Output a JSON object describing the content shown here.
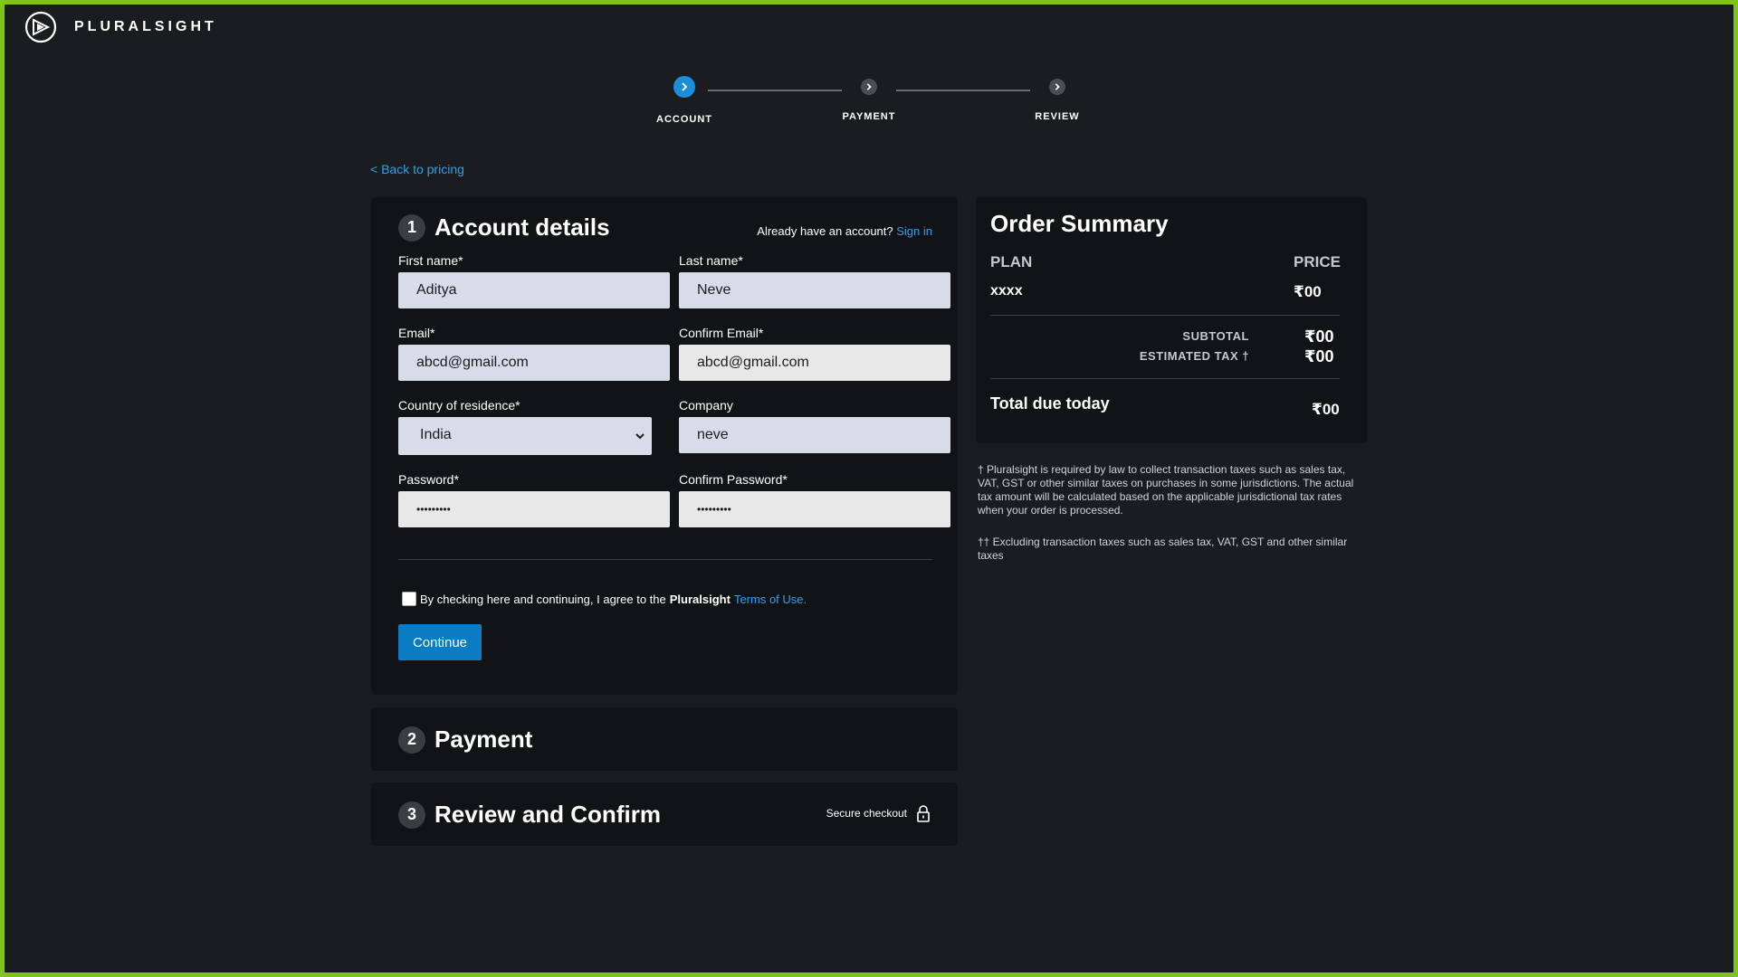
{
  "brand": {
    "name": "PLURALSIGHT"
  },
  "stepper": {
    "steps": [
      {
        "label": "ACCOUNT",
        "state": "active"
      },
      {
        "label": "PAYMENT",
        "state": "inactive"
      },
      {
        "label": "REVIEW",
        "state": "inactive"
      }
    ]
  },
  "back_link": "< Back to pricing",
  "account": {
    "number": "1",
    "title": "Account details",
    "signin_prompt": "Already have an account?",
    "signin_link": "Sign in",
    "fields": {
      "first_name": {
        "label": "First name*",
        "value": "Aditya"
      },
      "last_name": {
        "label": "Last name*",
        "value": "Neve"
      },
      "email": {
        "label": "Email*",
        "value": "abcd@gmail.com"
      },
      "confirm_email": {
        "label": "Confirm Email*",
        "value": "abcd@gmail.com"
      },
      "country": {
        "label": "Country of residence*",
        "value": "India"
      },
      "company": {
        "label": "Company",
        "value": "neve"
      },
      "password": {
        "label": "Password*",
        "value": "•••••••••"
      },
      "confirm_password": {
        "label": "Confirm Password*",
        "value": "•••••••••"
      }
    },
    "agree_prefix": "By checking here and continuing, I agree to the",
    "agree_brand": "Pluralsight",
    "agree_link": "Terms of Use.",
    "continue_label": "Continue"
  },
  "payment": {
    "number": "2",
    "title": "Payment"
  },
  "review": {
    "number": "3",
    "title": "Review and Confirm",
    "secure_label": "Secure checkout"
  },
  "summary": {
    "title": "Order Summary",
    "col_plan": "PLAN",
    "col_price": "PRICE",
    "plan_name": "xxxx",
    "plan_price": "₹00",
    "subtotal_label": "SUBTOTAL",
    "subtotal_value": "₹00",
    "tax_label": "ESTIMATED TAX †",
    "tax_value": "₹00",
    "total_label": "Total due today",
    "total_value": "₹00"
  },
  "footnotes": {
    "tax_note": "† Pluralsight is required by law to collect transaction taxes such as sales tax, VAT, GST or other similar taxes on purchases in some jurisdictions. The actual tax amount will be calculated based on the applicable jurisdictional tax rates when your order is processed.",
    "excl_note": "†† Excluding transaction taxes such as sales tax, VAT, GST and other similar taxes"
  },
  "colors": {
    "accent": "#1a8fd8",
    "link": "#2aa3ee",
    "frame": "#80c41c",
    "button": "#0a7cc4"
  }
}
